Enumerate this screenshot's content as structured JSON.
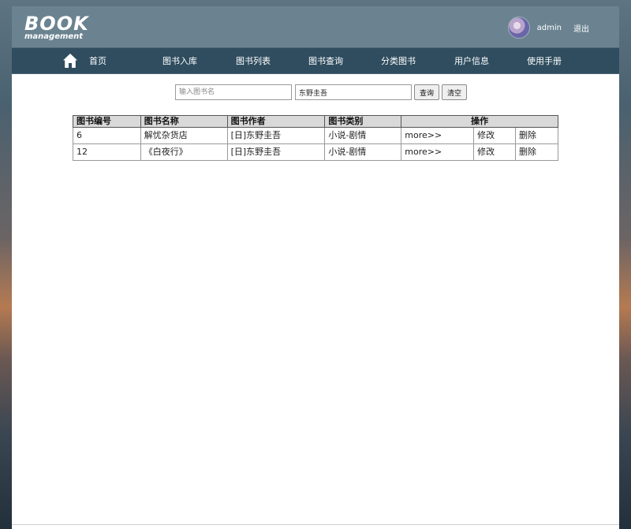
{
  "header": {
    "logo_main": "BOOK",
    "logo_sub": "management",
    "username": "admin",
    "logout_label": "退出"
  },
  "nav": {
    "home": "首页",
    "items": [
      "图书入库",
      "图书列表",
      "图书查询",
      "分类图书",
      "用户信息",
      "使用手册"
    ]
  },
  "search": {
    "name_placeholder": "输入图书名",
    "author_value": "东野圭吾",
    "query_label": "查询",
    "clear_label": "清空"
  },
  "table": {
    "columns": [
      "图书编号",
      "图书名称",
      "图书作者",
      "图书类别",
      "操作"
    ],
    "rows": [
      {
        "id": "6",
        "name": "解忧杂货店",
        "author": "[日]东野圭吾",
        "category": "小说-剧情",
        "more": "more>>",
        "edit": "修改",
        "delete": "删除"
      },
      {
        "id": "12",
        "name": "《白夜行》",
        "author": "[日]东野圭吾",
        "category": "小说-剧情",
        "more": "more>>",
        "edit": "修改",
        "delete": "删除"
      }
    ]
  },
  "colors": {
    "header_bg": "#6b8391",
    "nav_bg": "#2f4d5f",
    "table_header_bg": "#d9d9d9"
  }
}
